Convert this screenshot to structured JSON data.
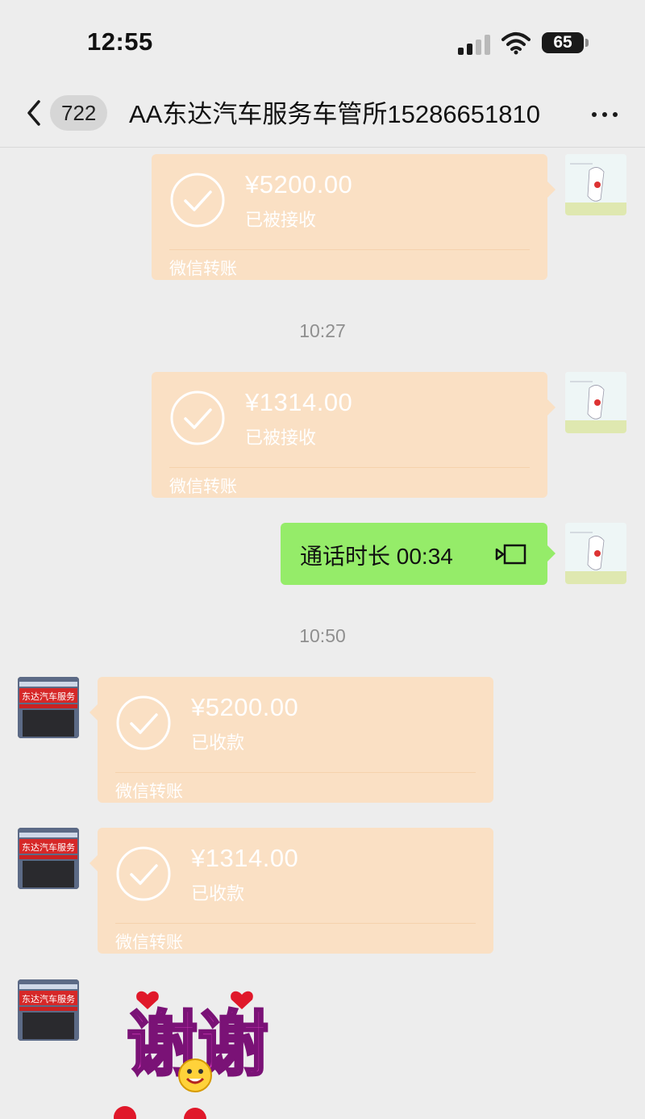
{
  "status_bar": {
    "time": "12:55",
    "battery": "65"
  },
  "nav": {
    "unread_count": "722",
    "title": "AA东达汽车服务车管所15286651810"
  },
  "messages": [
    {
      "amount": "¥5200.00",
      "status": "已被接收",
      "brand": "微信转账"
    },
    {
      "amount": "¥1314.00",
      "status": "已被接收",
      "brand": "微信转账"
    },
    {
      "amount": "¥5200.00",
      "status": "已收款",
      "brand": "微信转账"
    },
    {
      "amount": "¥1314.00",
      "status": "已收款",
      "brand": "微信转账"
    }
  ],
  "timestamps": [
    "10:27",
    "10:50"
  ],
  "call": {
    "text": "通话时长 00:34"
  },
  "sticker": {
    "text": "谢谢"
  },
  "avatar_shop_sign": "东达汽车服务",
  "colors": {
    "transfer_card": "#fae0c4",
    "call_bubble": "#95ec69",
    "background": "#ededed"
  }
}
